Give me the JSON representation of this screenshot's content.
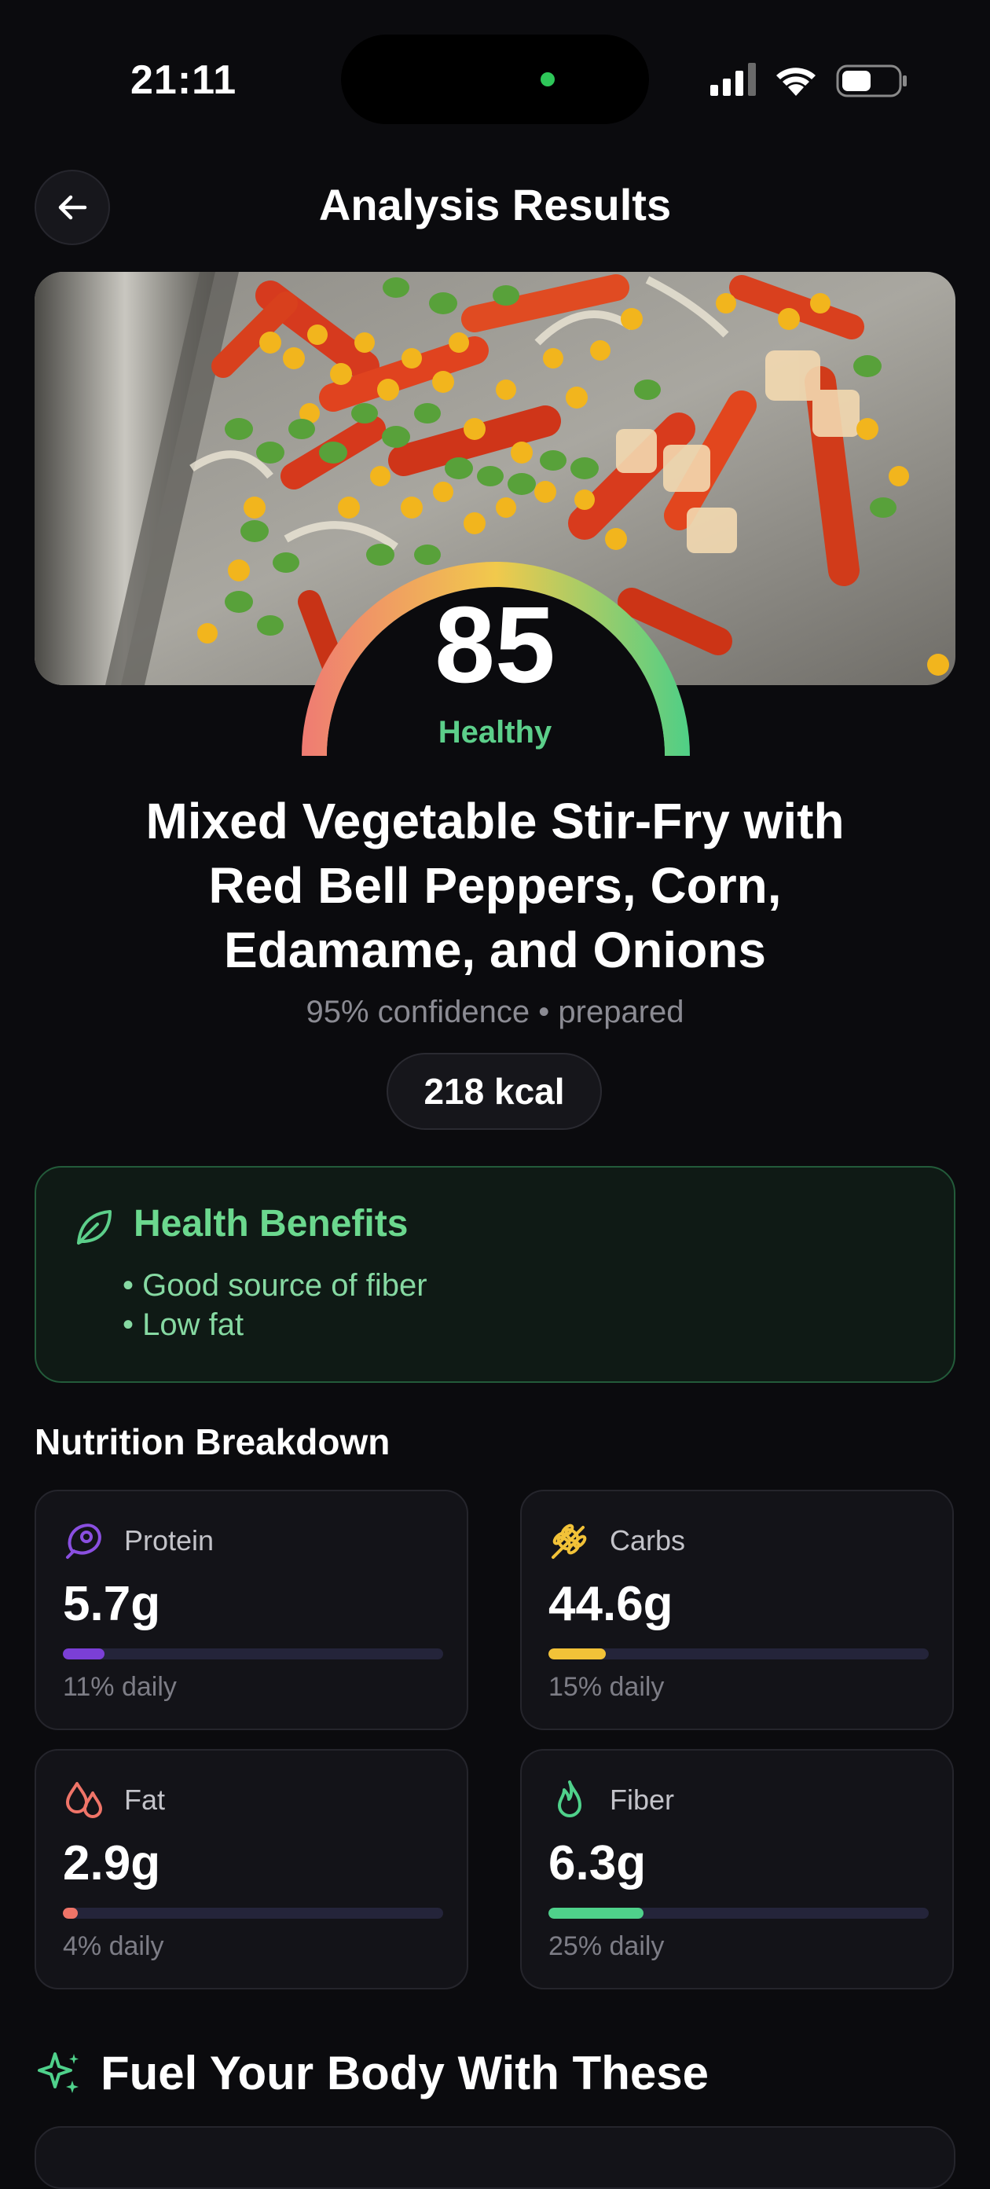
{
  "status_bar": {
    "time": "21:11"
  },
  "header": {
    "title": "Analysis Results"
  },
  "score": {
    "value": "85",
    "label": "Healthy",
    "level": 0.85
  },
  "food": {
    "name_lines": [
      "Mixed Vegetable Stir-Fry with",
      "Red Bell Peppers, Corn,",
      "Edamame, and Onions"
    ],
    "meta": "95% confidence • prepared",
    "kcal": "218 kcal"
  },
  "benefits": {
    "title": "Health Benefits",
    "items": [
      "• Good source of fiber",
      "• Low fat"
    ]
  },
  "nutrition": {
    "title": "Nutrition Breakdown",
    "cards": [
      {
        "label": "Protein",
        "value": "5.7g",
        "daily": "11% daily",
        "pct": 11,
        "color": "#7b3fd6",
        "icon": "meat-icon"
      },
      {
        "label": "Carbs",
        "value": "44.6g",
        "daily": "15% daily",
        "pct": 15,
        "color": "#f2c238",
        "icon": "wheat-icon"
      },
      {
        "label": "Fat",
        "value": "2.9g",
        "daily": "4% daily",
        "pct": 4,
        "color": "#ef7468",
        "icon": "droplets-icon"
      },
      {
        "label": "Fiber",
        "value": "6.3g",
        "daily": "25% daily",
        "pct": 25,
        "color": "#4fd18b",
        "icon": "flame-icon"
      }
    ]
  },
  "fuel": {
    "title": "Fuel Your Body With These"
  }
}
